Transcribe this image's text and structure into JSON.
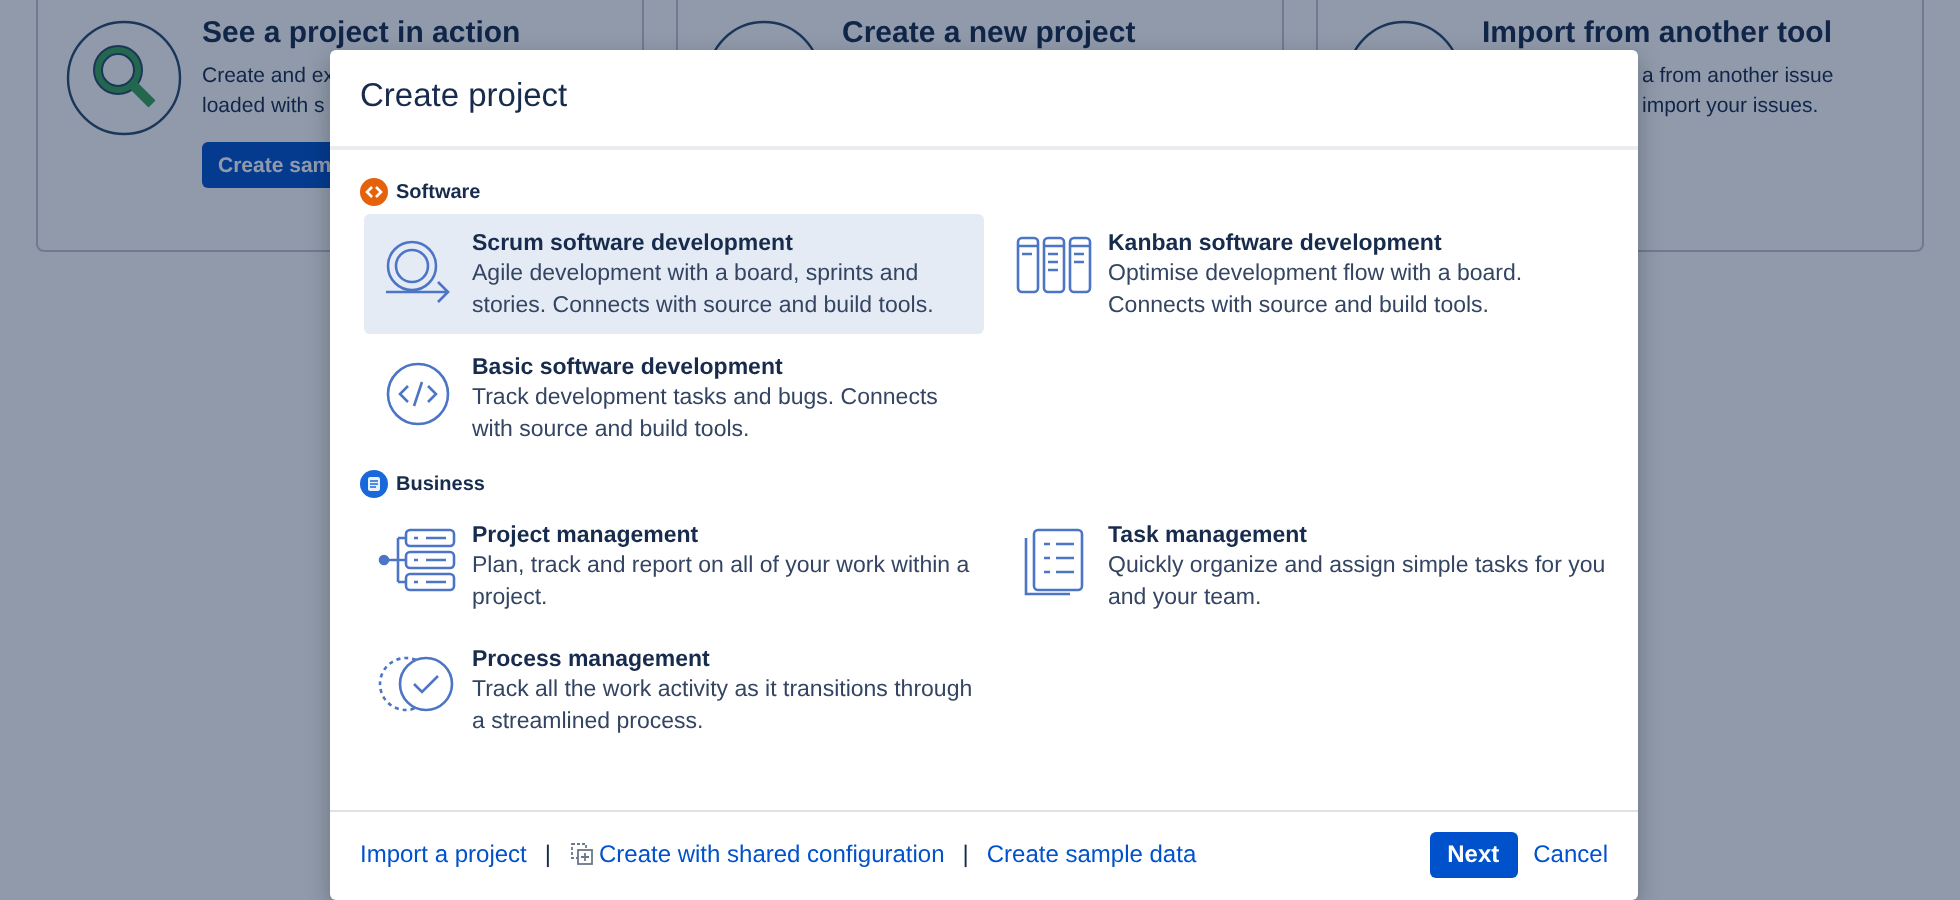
{
  "background_cards": [
    {
      "title": "See a project in action",
      "lines": [
        "Create and ex",
        "loaded with s"
      ],
      "button": "Create sam",
      "kind": "magnifier"
    },
    {
      "title": "Create a new project",
      "kind": "new"
    },
    {
      "title": "Import from another tool",
      "lines": [
        "a from another issue",
        "import your issues."
      ],
      "kind": "import"
    }
  ],
  "dialog": {
    "title": "Create project",
    "sections": [
      {
        "label": "Software",
        "kind": "software",
        "options": [
          {
            "title": "Scrum software development",
            "description": "Agile development with a board, sprints and stories. Connects with source and build tools.",
            "kind": "scrum",
            "selected": true
          },
          {
            "title": "Kanban software development",
            "description": "Optimise development flow with a board. Connects with source and build tools.",
            "kind": "kanban",
            "selected": false
          },
          {
            "title": "Basic software development",
            "description": "Track development tasks and bugs. Connects with source and build tools.",
            "kind": "basic",
            "selected": false
          }
        ]
      },
      {
        "label": "Business",
        "kind": "business",
        "options": [
          {
            "title": "Project management",
            "description": "Plan, track and report on all of your work within a project.",
            "kind": "project",
            "selected": false
          },
          {
            "title": "Task management",
            "description": "Quickly organize and assign simple tasks for you and your team.",
            "kind": "task",
            "selected": false
          },
          {
            "title": "Process management",
            "description": "Track all the work activity as it transitions through a streamlined process.",
            "kind": "process",
            "selected": false
          }
        ]
      }
    ],
    "footer_links": [
      {
        "label": "Import a project"
      },
      {
        "label": "Create with shared configuration",
        "icon": true
      },
      {
        "label": "Create sample data"
      }
    ],
    "separators": [
      "|",
      "|"
    ],
    "next_button": "Next",
    "cancel_link": "Cancel"
  }
}
